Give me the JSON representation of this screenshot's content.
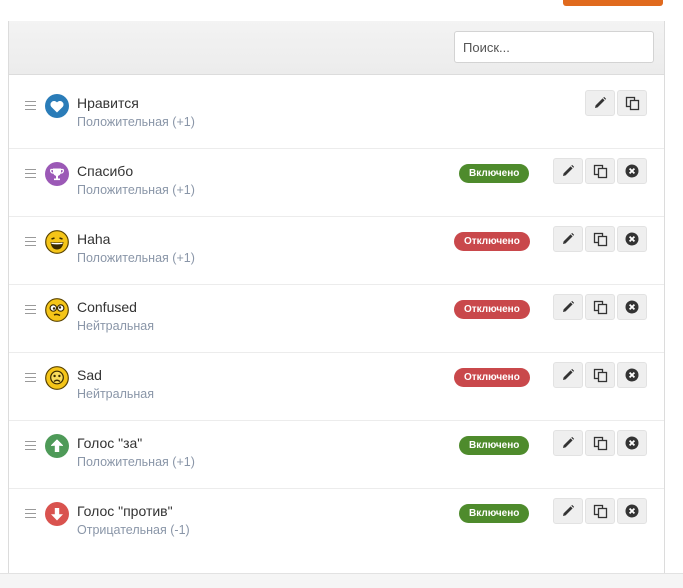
{
  "search": {
    "placeholder": "Поиск..."
  },
  "reactions": [
    {
      "title": "Нравится",
      "type": "Положительная (+1)",
      "status": "",
      "icon": "heart-icon",
      "color": "#2a7cb8"
    },
    {
      "title": "Спасибо",
      "type": "Положительная (+1)",
      "status": "Включено",
      "icon": "trophy-icon",
      "color": "#9b59b6"
    },
    {
      "title": "Haha",
      "type": "Положительная (+1)",
      "status": "Отключено",
      "icon": "laughing-face-icon",
      "color": "#f1c40f"
    },
    {
      "title": "Confused",
      "type": "Нейтральная",
      "status": "Отключено",
      "icon": "confused-face-icon",
      "color": "#f1c40f"
    },
    {
      "title": "Sad",
      "type": "Нейтральная",
      "status": "Отключено",
      "icon": "sad-face-icon",
      "color": "#f1c40f"
    },
    {
      "title": "Голос \"за\"",
      "type": "Положительная (+1)",
      "status": "Включено",
      "icon": "arrow-up-circle-icon",
      "color": "#4e9a58"
    },
    {
      "title": "Голос \"против\"",
      "type": "Отрицательная (-1)",
      "status": "Включено",
      "icon": "arrow-down-circle-icon",
      "color": "#d9534f"
    }
  ],
  "colors": {
    "enabled": "#4e8b2c",
    "disabled": "#c9484b",
    "accent": "#e06a1e"
  }
}
